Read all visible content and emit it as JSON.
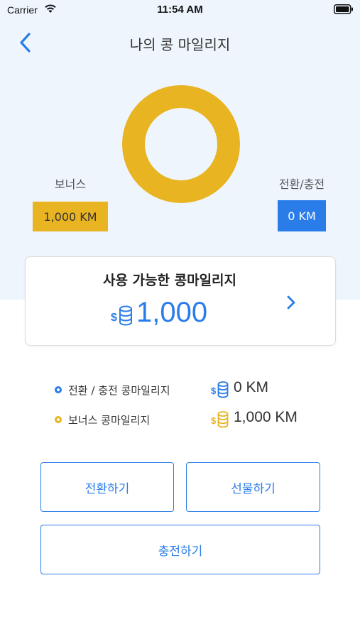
{
  "status_bar": {
    "carrier": "Carrier",
    "time": "11:54 AM"
  },
  "header": {
    "title": "나의 콩 마일리지"
  },
  "summary": {
    "bonus_label": "보너스",
    "bonus_value": "1,000 KM",
    "conversion_label": "전환/충전",
    "conversion_value": "0 KM"
  },
  "available": {
    "title": "사용 가능한 콩마일리지",
    "value": "1,000"
  },
  "legend": [
    {
      "label": "전환 / 충전 콩마일리지",
      "value": "0 KM",
      "color": "#2a7de9"
    },
    {
      "label": "보너스 콩마일리지",
      "value": "1,000 KM",
      "color": "#e9b422"
    }
  ],
  "actions": {
    "convert": "전환하기",
    "gift": "선물하기",
    "charge": "충전하기"
  },
  "colors": {
    "accent_blue": "#2a7de9",
    "bonus_yellow": "#e9b422",
    "top_background": "#eef5fd"
  },
  "chart_data": {
    "type": "pie",
    "categories": [
      "보너스",
      "전환/충전"
    ],
    "values": [
      1000,
      0
    ],
    "title": "",
    "xlabel": "",
    "ylabel": ""
  }
}
